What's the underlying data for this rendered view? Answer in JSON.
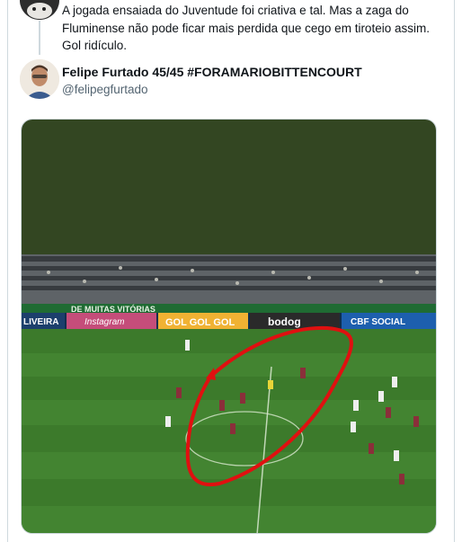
{
  "previous_tweet": {
    "text": "A jogada ensaiada do Juventude foi criativa e tal. Mas a zaga do Fluminense não pode ficar mais perdida que cego em tiroteio assim. Gol ridículo."
  },
  "tweet": {
    "display_name": "Felipe Furtado 45/45 #FORAMARIOBITTENCOURT",
    "handle": "@felipegfurtado"
  },
  "media": {
    "banners": [
      "LIVEIRA",
      "Instagram",
      "GOL GOL GOL",
      "bodog",
      "CBF SOCIAL"
    ],
    "upper_text": "DE MUITAS VITÓRIAS",
    "colors": {
      "top_area": "#334622",
      "pitch": "#3c7a2b",
      "annotation": "#e01010"
    }
  },
  "icons": {
    "avatar_prev": "dog-avatar-icon",
    "avatar_main": "profile-photo-icon"
  }
}
